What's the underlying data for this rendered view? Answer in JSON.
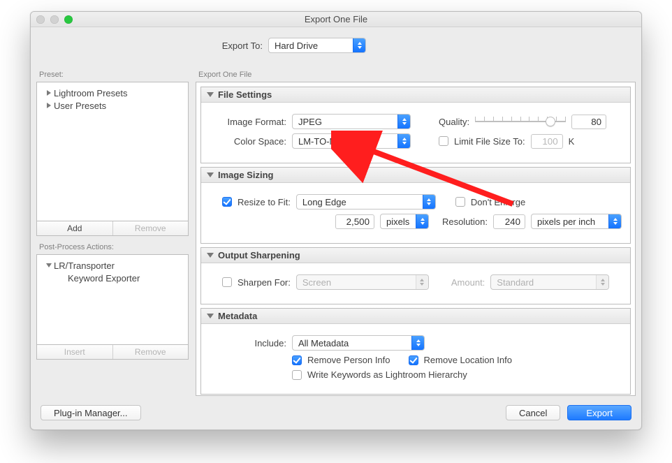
{
  "window_title": "Export One File",
  "export_to": {
    "label": "Export To:",
    "value": "Hard Drive"
  },
  "preset_section_label": "Preset:",
  "right_section_label": "Export One File",
  "presets": {
    "items": [
      "Lightroom Presets",
      "User Presets"
    ]
  },
  "preset_buttons": {
    "add": "Add",
    "remove": "Remove"
  },
  "ppa_label": "Post-Process Actions:",
  "ppa": {
    "root": "LR/Transporter",
    "child": "Keyword Exporter"
  },
  "ppa_buttons": {
    "insert": "Insert",
    "remove": "Remove"
  },
  "panels": {
    "file_settings": {
      "title": "File Settings",
      "image_format_label": "Image Format:",
      "image_format_value": "JPEG",
      "quality_label": "Quality:",
      "quality_value": "80",
      "color_space_label": "Color Space:",
      "color_space_value": "LM-TO-Merope",
      "limit_label": "Limit File Size To:",
      "limit_value": "100",
      "limit_unit": "K"
    },
    "image_sizing": {
      "title": "Image Sizing",
      "resize_label": "Resize to Fit:",
      "resize_value": "Long Edge",
      "dont_enlarge": "Don't Enlarge",
      "size_value": "2,500",
      "size_unit": "pixels",
      "resolution_label": "Resolution:",
      "resolution_value": "240",
      "resolution_unit": "pixels per inch"
    },
    "output_sharpening": {
      "title": "Output Sharpening",
      "sharpen_label": "Sharpen For:",
      "sharpen_value": "Screen",
      "amount_label": "Amount:",
      "amount_value": "Standard"
    },
    "metadata": {
      "title": "Metadata",
      "include_label": "Include:",
      "include_value": "All Metadata",
      "remove_person": "Remove Person Info",
      "remove_location": "Remove Location Info",
      "write_keywords": "Write Keywords as Lightroom Hierarchy"
    }
  },
  "footer": {
    "plugin": "Plug-in Manager...",
    "cancel": "Cancel",
    "export": "Export"
  }
}
